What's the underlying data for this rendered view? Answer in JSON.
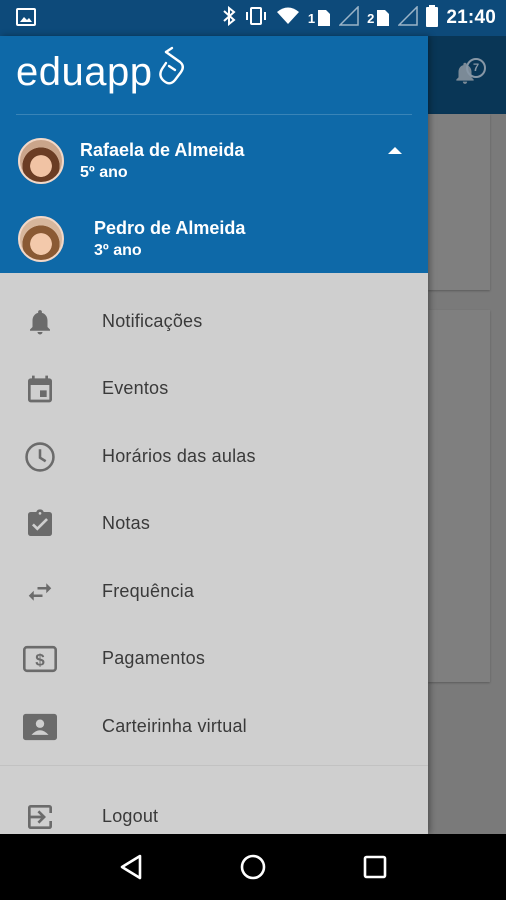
{
  "status_bar": {
    "time": "21:40",
    "sim1_label": "1",
    "sim2_label": "2",
    "icons": [
      "image-icon",
      "bluetooth-icon",
      "vibrate-icon",
      "wifi-icon",
      "signal-icon",
      "battery-icon"
    ]
  },
  "app": {
    "logo_text": "eduapp",
    "notification_count": "7"
  },
  "profiles": [
    {
      "name": "Rafaela de Almeida",
      "grade": "5º ano",
      "expanded": true
    },
    {
      "name": "Pedro de Almeida",
      "grade": "3º ano"
    }
  ],
  "menu": {
    "items": [
      {
        "label": "Notificações",
        "icon": "bell-icon"
      },
      {
        "label": "Eventos",
        "icon": "calendar-icon"
      },
      {
        "label": "Horários das aulas",
        "icon": "clock-icon"
      },
      {
        "label": "Notas",
        "icon": "clipboard-check-icon"
      },
      {
        "label": "Frequência",
        "icon": "swap-arrows-icon"
      },
      {
        "label": "Pagamentos",
        "icon": "dollar-bill-icon"
      },
      {
        "label": "Carteirinha virtual",
        "icon": "id-card-icon"
      }
    ],
    "logout_label": "Logout"
  },
  "colors": {
    "header_blue": "#0e69a8",
    "status_bar": "#0d4a7a",
    "drawer_bg": "#cfcfcf",
    "icon_gray": "#6b6b6b"
  }
}
